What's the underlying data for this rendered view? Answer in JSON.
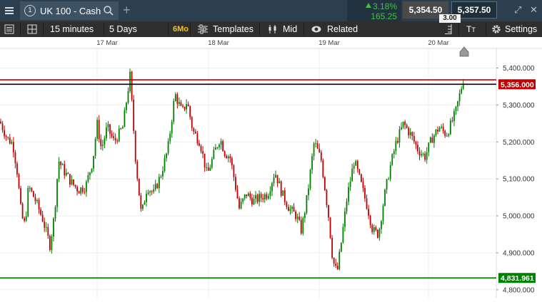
{
  "topbar": {
    "tab_number": "1",
    "instrument": "UK 100 - Cash",
    "change_pct": "3.18%",
    "change_abs": "165.25",
    "sell_price": "5,354.50",
    "buy_price": "5,357.50",
    "spread": "3.00"
  },
  "toolbar": {
    "timeframe": "15 minutes",
    "range": "5 Days",
    "six_month": "6Mo",
    "templates": "Templates",
    "price_type": "Mid",
    "related": "Related",
    "settings": "Settings"
  },
  "chart_data": {
    "type": "candlestick",
    "x_ticks": [
      "17 Mar",
      "18 Mar",
      "19 Mar",
      "20 Mar"
    ],
    "y_ticks": [
      "5,400.000",
      "5,300.000",
      "5,200.000",
      "5,100.000",
      "5,000.000",
      "4,900.000",
      "4,800.000"
    ],
    "ylim": [
      4790,
      5453
    ],
    "grid": true,
    "horizontal_lines": [
      {
        "value": 5368,
        "color": "#c00000"
      },
      {
        "value": 5356,
        "color": "#000000",
        "label": "5,356.000",
        "label_color": "#c00000"
      },
      {
        "value": 4831.961,
        "color": "#008000",
        "label": "4,831.961",
        "label_color": "#008000"
      }
    ],
    "colors": {
      "up": "#008000",
      "down": "#c00000"
    },
    "waypoints": [
      [
        0,
        5255
      ],
      [
        10,
        5210
      ],
      [
        18,
        5195
      ],
      [
        24,
        5120
      ],
      [
        30,
        5000
      ],
      [
        35,
        4975
      ],
      [
        40,
        5080
      ],
      [
        50,
        5040
      ],
      [
        60,
        4990
      ],
      [
        70,
        4920
      ],
      [
        76,
        5000
      ],
      [
        82,
        5150
      ],
      [
        90,
        5120
      ],
      [
        100,
        5090
      ],
      [
        110,
        5070
      ],
      [
        120,
        5080
      ],
      [
        130,
        5150
      ],
      [
        136,
        5250
      ],
      [
        142,
        5180
      ],
      [
        150,
        5240
      ],
      [
        160,
        5200
      ],
      [
        172,
        5240
      ],
      [
        182,
        5380
      ],
      [
        190,
        5150
      ],
      [
        198,
        5000
      ],
      [
        206,
        5080
      ],
      [
        215,
        5060
      ],
      [
        225,
        5110
      ],
      [
        235,
        5180
      ],
      [
        245,
        5330
      ],
      [
        255,
        5280
      ],
      [
        262,
        5310
      ],
      [
        270,
        5230
      ],
      [
        280,
        5200
      ],
      [
        290,
        5110
      ],
      [
        300,
        5170
      ],
      [
        308,
        5210
      ],
      [
        315,
        5170
      ],
      [
        322,
        5160
      ],
      [
        328,
        5100
      ],
      [
        335,
        5020
      ],
      [
        345,
        5060
      ],
      [
        355,
        5040
      ],
      [
        365,
        5050
      ],
      [
        375,
        5060
      ],
      [
        385,
        5120
      ],
      [
        395,
        5060
      ],
      [
        405,
        5020
      ],
      [
        415,
        5000
      ],
      [
        422,
        4960
      ],
      [
        430,
        5050
      ],
      [
        440,
        5200
      ],
      [
        450,
        5150
      ],
      [
        460,
        5000
      ],
      [
        466,
        4880
      ],
      [
        472,
        4845
      ],
      [
        478,
        4930
      ],
      [
        486,
        5050
      ],
      [
        496,
        5150
      ],
      [
        505,
        5090
      ],
      [
        515,
        5020
      ],
      [
        522,
        4960
      ],
      [
        530,
        4950
      ],
      [
        538,
        5050
      ],
      [
        546,
        5130
      ],
      [
        555,
        5200
      ],
      [
        565,
        5250
      ],
      [
        575,
        5220
      ],
      [
        585,
        5180
      ],
      [
        595,
        5160
      ],
      [
        605,
        5210
      ],
      [
        615,
        5240
      ],
      [
        625,
        5220
      ],
      [
        632,
        5250
      ],
      [
        638,
        5280
      ],
      [
        644,
        5330
      ],
      [
        650,
        5380
      ]
    ]
  }
}
